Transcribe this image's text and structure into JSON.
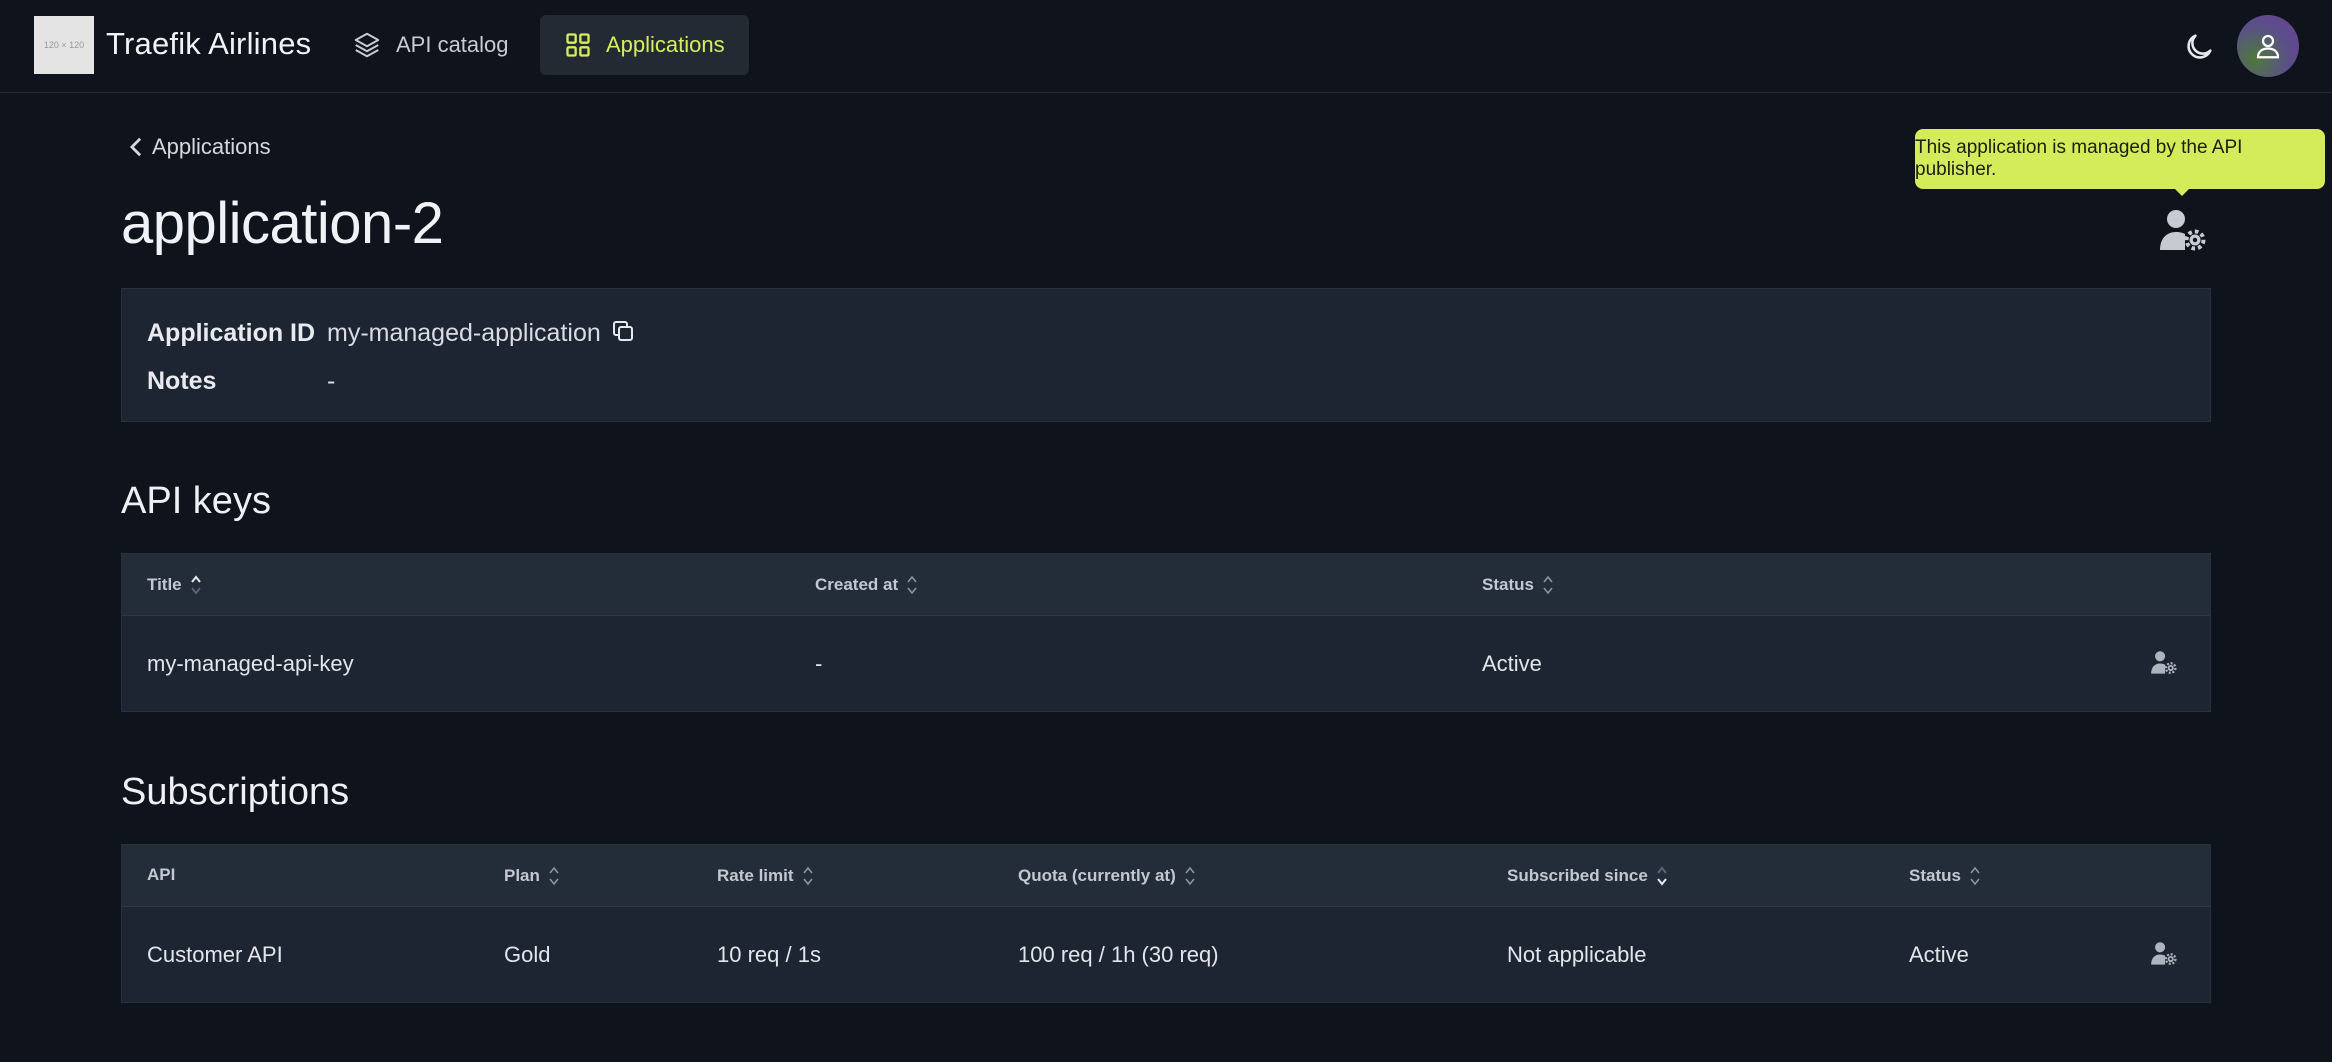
{
  "header": {
    "logo_text": "120 × 120",
    "brand": "Traefik Airlines",
    "nav": [
      {
        "label": "API catalog",
        "active": false
      },
      {
        "label": "Applications",
        "active": true
      }
    ]
  },
  "breadcrumb": {
    "back_label": "Applications"
  },
  "page_title": "application-2",
  "tooltip": "This application is managed by the API publisher.",
  "info": {
    "app_id_label": "Application ID",
    "app_id_value": "my-managed-application",
    "notes_label": "Notes",
    "notes_value": "-"
  },
  "api_keys": {
    "title": "API keys",
    "columns": [
      "Title",
      "Created at",
      "Status"
    ],
    "rows": [
      {
        "title": "my-managed-api-key",
        "created_at": "-",
        "status": "Active"
      }
    ]
  },
  "subscriptions": {
    "title": "Subscriptions",
    "columns": [
      "API",
      "Plan",
      "Rate limit",
      "Quota (currently at)",
      "Subscribed since",
      "Status"
    ],
    "rows": [
      {
        "api": "Customer API",
        "plan": "Gold",
        "rate_limit": "10 req / 1s",
        "quota": "100 req / 1h (30 req)",
        "since": "Not applicable",
        "status": "Active"
      }
    ]
  },
  "colors": {
    "accent": "#d7ee5c",
    "background": "#0f131c",
    "card": "#1d2532"
  }
}
